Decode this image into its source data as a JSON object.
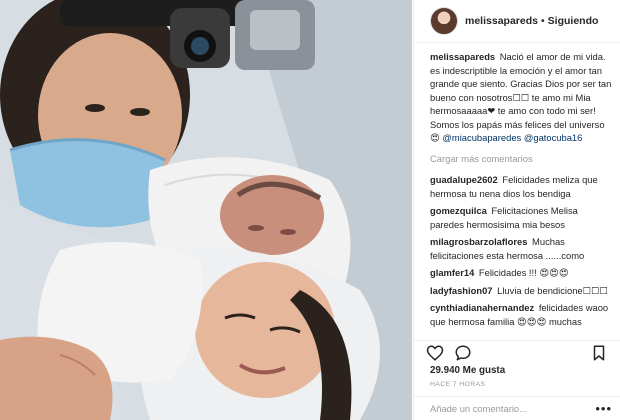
{
  "post_image": {
    "alt": "",
    "colors": {
      "drape": "#d3dbe0",
      "mask": "#8fc1e0",
      "skin": "#e6b79a",
      "hair": "#2b211d",
      "blanket": "#f2f2f2"
    }
  },
  "header": {
    "username": "melissapareds",
    "separator": "•",
    "follow_label": "Siguiendo"
  },
  "caption": {
    "username": "melissapareds",
    "text": "Nació el amor de mi vida. es indescriptible la emoción y el amor tan grande que siento. Gracias Dios por ser tan bueno con nosotros☐☐ te amo mi Mia hermosaaaaa❤ te amo con todo mi ser! Somos los papás más felices del universo😍 ",
    "mention_1": "@miacubaparedes",
    "mention_2": "@gatocuba16"
  },
  "load_more": "Cargar más comentarios",
  "comments": [
    {
      "user": "guadalupe2602",
      "text": "Felicidades meliza que hermosa tu nena dios los bendiga"
    },
    {
      "user": "gomezquilca",
      "text": "Felicitaciones Melisa paredes hermosisima mia besos"
    },
    {
      "user": "milagrosbarzolaflores",
      "text": "Muchas felicitaciones esta hermosa ......como"
    },
    {
      "user": "glamfer14",
      "text": "Felicidades !!! 😍😍😍"
    },
    {
      "user": "ladyfashion07",
      "text": "Lluvia de bendicione☐☐☐"
    },
    {
      "user": "cynthiadianahernandez",
      "text": "felicidades waoo que hermosa familia 😍😍😍 muchas"
    }
  ],
  "actions": {
    "like_icon": "heart-icon",
    "comment_icon": "comment-icon",
    "save_icon": "bookmark-icon"
  },
  "likes_text": "29.940 Me gusta",
  "time_text": "HACE 7 HORAS",
  "add_comment": {
    "placeholder": "Añade un comentario...",
    "more_label": "•••"
  }
}
